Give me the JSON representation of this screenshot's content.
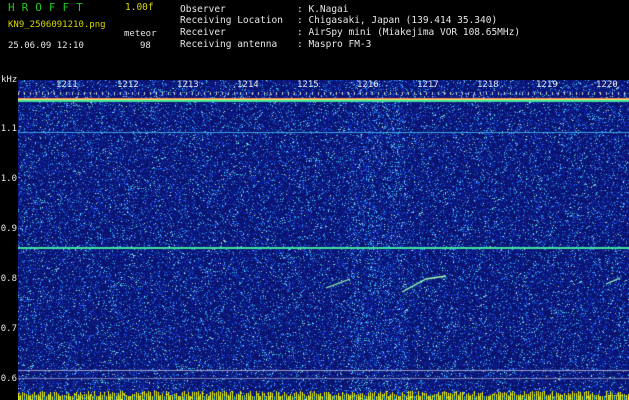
{
  "header": {
    "app_title": "HROFFT",
    "version": "1.00f",
    "filename": "KN9_2506091210.png",
    "datetime": "25.06.09 12:10",
    "meteor_label": "meteor",
    "meteor_count": "98",
    "info": [
      {
        "key": "Observer",
        "value": ": K.Nagai"
      },
      {
        "key": "Receiving Location",
        "value": ": Chigasaki, Japan (139.414 35.340)"
      },
      {
        "key": "Receiver",
        "value": ": AirSpy mini (Miakejima VOR 108.65MHz)"
      },
      {
        "key": "Receiving antenna",
        "value": ": Maspro FM-3"
      }
    ]
  },
  "axis": {
    "y_unit": "kHz",
    "y_labels": [
      "1.1",
      "1.0",
      "0.9",
      "0.8",
      "0.7",
      "0.6"
    ],
    "x_labels": [
      "1211",
      "1212",
      "1213",
      "1214",
      "1215",
      "1216",
      "1217",
      "1218",
      "1219",
      "1220"
    ]
  },
  "colors": {
    "background": "#0a1470",
    "header_green": "#1ec81e",
    "header_yellow": "#d8d800",
    "carrier": "#40e0a0",
    "meteor": "#a0ffb0",
    "noise_floor": "#f0f000"
  }
}
